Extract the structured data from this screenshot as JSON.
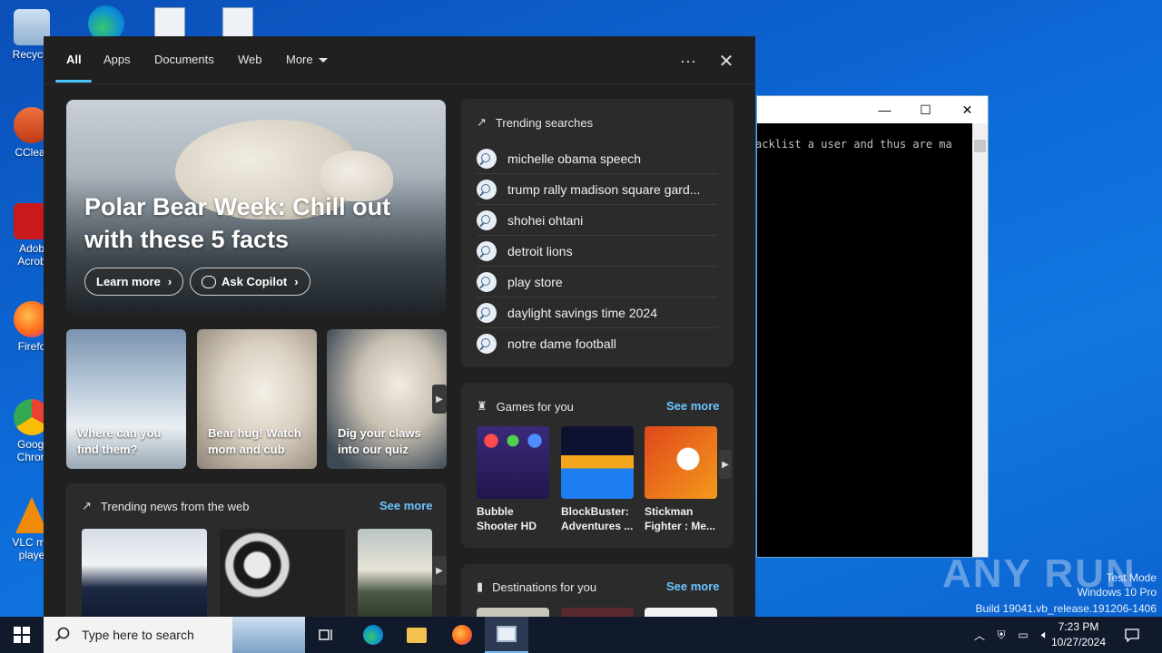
{
  "desktop": {
    "icons": [
      {
        "label": "Recycle",
        "color": "#9ab8d8"
      },
      {
        "label": "CClear",
        "color": "#e05a2a"
      },
      {
        "label": "Adob Acrob",
        "color": "#c8191d"
      },
      {
        "label": "Firefo",
        "color": "#ff7a1a"
      },
      {
        "label": "Googl Chron",
        "color": "#34a853"
      },
      {
        "label": "VLC me playe",
        "color": "#f08a0a"
      }
    ]
  },
  "console": {
    "text": "acklist a user and thus are ma",
    "minimize": "—",
    "maximize": "☐",
    "close": "✕"
  },
  "watermark": {
    "logo": "ANY RUN",
    "line1": "Test Mode",
    "line2": "Windows 10 Pro",
    "line3": "Build 19041.vb_release.191206-1406"
  },
  "panel": {
    "tabs": [
      "All",
      "Apps",
      "Documents",
      "Web",
      "More"
    ],
    "active_tab": "All",
    "more_options": "···",
    "close": "✕",
    "hero": {
      "title": "Polar Bear Week: Chill out with these 5 facts",
      "learn_more": "Learn more",
      "ask_copilot": "Ask Copilot"
    },
    "cards": [
      {
        "label": "Where can you find them?"
      },
      {
        "label": "Bear hug! Watch mom and cub"
      },
      {
        "label": "Dig your claws into our quiz"
      }
    ],
    "news": {
      "title": "Trending news from the web",
      "see_more": "See more"
    },
    "trending": {
      "title": "Trending searches",
      "items": [
        "michelle obama speech",
        "trump rally madison square gard...",
        "shohei ohtani",
        "detroit lions",
        "play store",
        "daylight savings time 2024",
        "notre dame football"
      ]
    },
    "games": {
      "title": "Games for you",
      "see_more": "See more",
      "items": [
        {
          "name": "Bubble Shooter HD"
        },
        {
          "name": "BlockBuster: Adventures ..."
        },
        {
          "name": "Stickman Fighter : Me..."
        }
      ]
    },
    "destinations": {
      "title": "Destinations for you",
      "see_more": "See more"
    }
  },
  "taskbar": {
    "search_placeholder": "Type here to search",
    "time": "7:23 PM",
    "date": "10/27/2024"
  }
}
